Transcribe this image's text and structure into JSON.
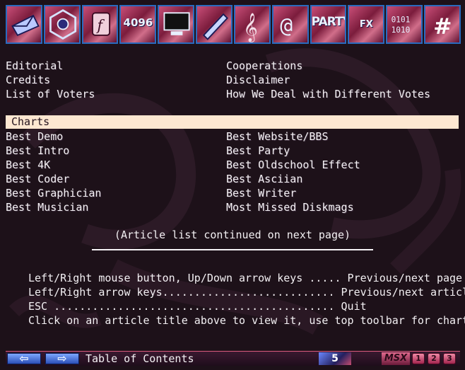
{
  "toolbar": {
    "icons": [
      {
        "name": "envelope-icon",
        "text": ""
      },
      {
        "name": "disk-eye-icon",
        "text": ""
      },
      {
        "name": "scroll-icon",
        "text": ""
      },
      {
        "name": "4096-icon",
        "text": "4096"
      },
      {
        "name": "monitor-icon",
        "text": ""
      },
      {
        "name": "pencil-icon",
        "text": ""
      },
      {
        "name": "music-clef-icon",
        "text": ""
      },
      {
        "name": "ascii-at-icon",
        "text": ""
      },
      {
        "name": "party-icon",
        "text": "PARTY"
      },
      {
        "name": "fx-icon",
        "text": "FX"
      },
      {
        "name": "binary-icon",
        "text": ""
      },
      {
        "name": "hash-icon",
        "text": ""
      }
    ]
  },
  "menu": {
    "top_left": [
      "Editorial",
      "Credits",
      "List of Voters"
    ],
    "top_right": [
      "Cooperations",
      "Disclaimer",
      "How We Deal with Different Votes"
    ],
    "section_title": "Charts",
    "charts_left": [
      "Best Demo",
      "Best Intro",
      "Best 4K",
      "Best Coder",
      "Best Graphician",
      "Best Musician"
    ],
    "charts_right": [
      "Best Website/BBS",
      "Best Party",
      "Best Oldschool Effect",
      "Best Asciian",
      "Best Writer",
      "Most Missed Diskmags"
    ],
    "continued_note": "(Article list continued on next page)"
  },
  "help": {
    "lines": [
      "Left/Right mouse button, Up/Down arrow keys ..... Previous/next page",
      "Left/Right arrow keys........................... Previous/next article",
      "ESC ............................................ Quit",
      "Click on an article title above to view it, use top toolbar for charts."
    ]
  },
  "bottombar": {
    "prev_label": "⇦",
    "next_label": "⇨",
    "title": "Table of Contents",
    "issue": "5",
    "logo_text": "MSX",
    "pages": [
      "1",
      "2",
      "3"
    ]
  },
  "colors": {
    "background": "#1d1119",
    "text": "#f4f1f4",
    "section_bar": "#fde7d1",
    "toolbar_border": "#2a6bbf"
  }
}
